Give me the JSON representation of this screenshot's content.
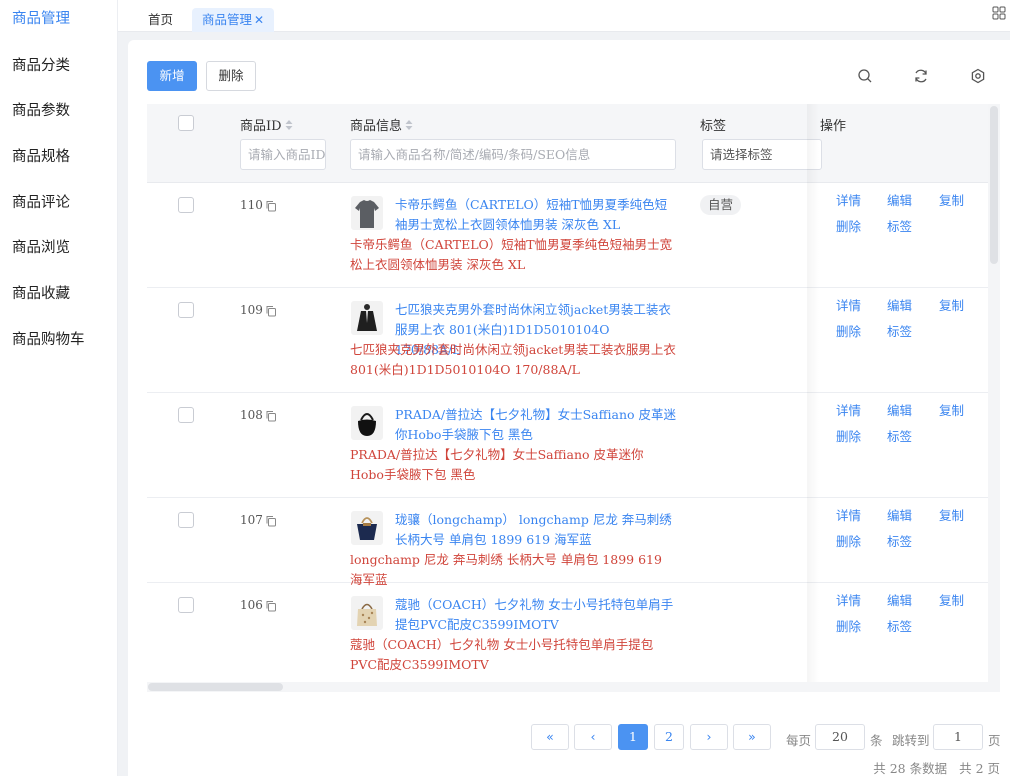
{
  "sidebar": {
    "items": [
      {
        "label": "商品管理",
        "active": true
      },
      {
        "label": "商品分类"
      },
      {
        "label": "商品参数"
      },
      {
        "label": "商品规格"
      },
      {
        "label": "商品评论"
      },
      {
        "label": "商品浏览"
      },
      {
        "label": "商品收藏"
      },
      {
        "label": "商品购物车"
      }
    ]
  },
  "tabs": [
    {
      "label": "首页"
    },
    {
      "label": "商品管理",
      "active": true,
      "close_glyph": "✕"
    }
  ],
  "toolbar": {
    "add_label": "新增",
    "delete_label": "删除",
    "icons": [
      "search-icon",
      "refresh-icon",
      "settings-icon"
    ]
  },
  "table": {
    "columns": {
      "id": "商品ID",
      "info": "商品信息",
      "tag": "标签",
      "actions": "操作"
    },
    "filters": {
      "id_placeholder": "请输入商品ID",
      "info_placeholder": "请输入商品名称/简述/编码/条码/SEO信息",
      "tag_placeholder": "请选择标签"
    },
    "action_labels": {
      "detail": "详情",
      "edit": "编辑",
      "copy": "复制",
      "delete": "删除",
      "tag": "标签"
    },
    "rows": [
      {
        "id": "110",
        "title": "卡帝乐鳄鱼（CARTELO）短袖T恤男夏季纯色短袖男士宽松上衣圆领体恤男装 深灰色 XL",
        "subtitle": "卡帝乐鳄鱼（CARTELO）短袖T恤男夏季纯色短袖男士宽松上衣圆领体恤男装 深灰色 XL",
        "tag": "自营",
        "image": "gray-tshirt"
      },
      {
        "id": "109",
        "title": "七匹狼夹克男外套时尚休闲立领jacket男装工装衣服男上衣 801(米白)1D1D5010104O 170/88A/L",
        "subtitle": "七匹狼夹克男外套时尚休闲立领jacket男装工装衣服男上衣 801(米白)1D1D5010104O 170/88A/L",
        "tag": "",
        "image": "black-jacket"
      },
      {
        "id": "108",
        "title": "PRADA/普拉达【七夕礼物】女士Saffiano 皮革迷你Hobo手袋腋下包 黑色",
        "subtitle": "PRADA/普拉达【七夕礼物】女士Saffiano 皮革迷你Hobo手袋腋下包 黑色",
        "tag": "",
        "image": "black-handbag"
      },
      {
        "id": "107",
        "title": "珑骧（longchamp） longchamp 尼龙 奔马刺绣 长柄大号 单肩包 1899 619 海军蓝",
        "subtitle": "longchamp 尼龙 奔马刺绣 长柄大号 单肩包 1899 619 海军蓝",
        "tag": "",
        "image": "navy-tote"
      },
      {
        "id": "106",
        "title": "蔻驰（COACH）七夕礼物 女士小号托特包单肩手提包PVC配皮C3599IMOTV",
        "subtitle": "蔻驰（COACH）七夕礼物 女士小号托特包单肩手提包PVC配皮C3599IMOTV",
        "tag": "",
        "image": "coach-tote"
      }
    ]
  },
  "pagination": {
    "first": "«",
    "prev": "‹",
    "pages": [
      "1",
      "2"
    ],
    "current_page": "1",
    "next": "›",
    "last": "»",
    "per_page_label": "每页",
    "per_page_value": "20",
    "per_page_unit": "条",
    "jump_label": "跳转到",
    "jump_value": "1",
    "jump_unit": "页",
    "total_label": "共 28 条数据",
    "total_pages_label": "共 2 页"
  },
  "colors": {
    "accent": "#3a85f0",
    "primary_button": "#4b93f2",
    "subtitle_red": "#d0453b"
  }
}
